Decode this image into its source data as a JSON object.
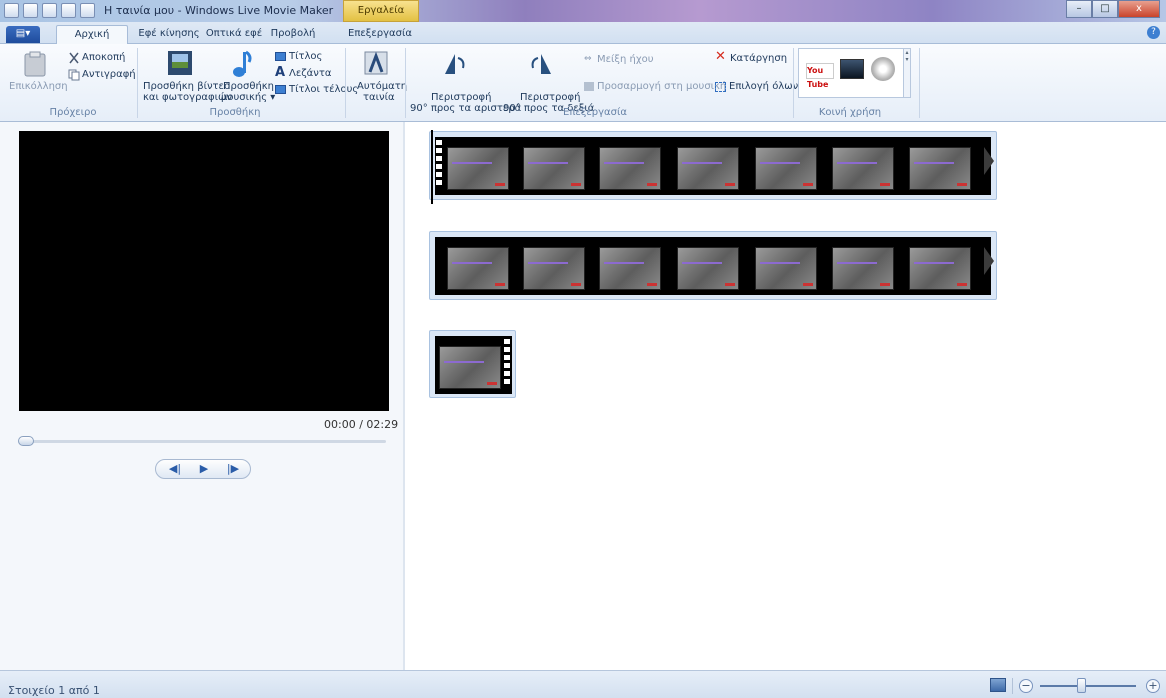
{
  "window": {
    "title": "Η ταινία μου - Windows Live Movie Maker",
    "context_tab": "Εργαλεία βίντεο",
    "minimize": "–",
    "maximize": "□",
    "close": "x"
  },
  "file_button": "▤▾",
  "tabs": [
    "Αρχική σελίδα",
    "Εφέ κίνησης",
    "Οπτικά εφέ",
    "Προβολή",
    "Επεξεργασία"
  ],
  "ribbon": {
    "clipboard": {
      "paste": "Επικόλληση",
      "cut": "Αποκοπή",
      "copy": "Αντιγραφή",
      "group": "Πρόχειρο"
    },
    "add": {
      "add_video_line1": "Προσθήκη βίντεο",
      "add_video_line2": "και φωτογραφιών",
      "add_music_line1": "Προσθήκη",
      "add_music_line2": "μουσικής ▾",
      "title": "Τίτλος",
      "caption": "Λεζάντα",
      "credits": "Τίτλοι τέλους",
      "group": "Προσθήκη"
    },
    "automovie": {
      "line1": "Αυτόματη",
      "line2": "ταινία"
    },
    "editing": {
      "rotate_left_line1": "Περιστροφή",
      "rotate_left_line2": "90° προς τα αριστερά",
      "rotate_right_line1": "Περιστροφή",
      "rotate_right_line2": "90° προς τα δεξιά",
      "audio_mix": "Μείξη ήχου",
      "fit_to_music": "Προσαρμογή στη μουσική",
      "remove": "Κατάργηση",
      "select_all": "Επιλογή όλων",
      "group": "Επεξεργασία"
    },
    "share": {
      "youtube": "You Tube",
      "group": "Κοινή χρήση"
    }
  },
  "preview": {
    "time": "00:00 / 02:29",
    "prev_frame": "◀|",
    "play": "▶",
    "next_frame": "|▶"
  },
  "status": {
    "text": "Στοιχείο 1 από 1",
    "zoom_out": "−",
    "zoom_in": "+"
  }
}
